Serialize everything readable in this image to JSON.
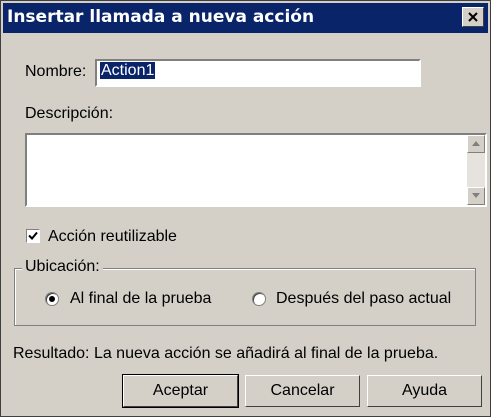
{
  "window": {
    "title": "Insertar llamada a nueva acción",
    "close_icon": "close-icon"
  },
  "form": {
    "name_label": "Nombre:",
    "name_value": "Action1",
    "description_label": "Descripción:",
    "description_value": "",
    "reusable_label": "Acción reutilizable",
    "reusable_checked": true
  },
  "location": {
    "label": "Ubicación:",
    "options": [
      {
        "label": "Al final de la prueba",
        "selected": true
      },
      {
        "label": "Después del paso actual",
        "selected": false
      }
    ]
  },
  "result_text": "Resultado: La nueva acción se añadirá al final de la prueba.",
  "buttons": {
    "ok": "Aceptar",
    "cancel": "Cancelar",
    "help": "Ayuda"
  }
}
